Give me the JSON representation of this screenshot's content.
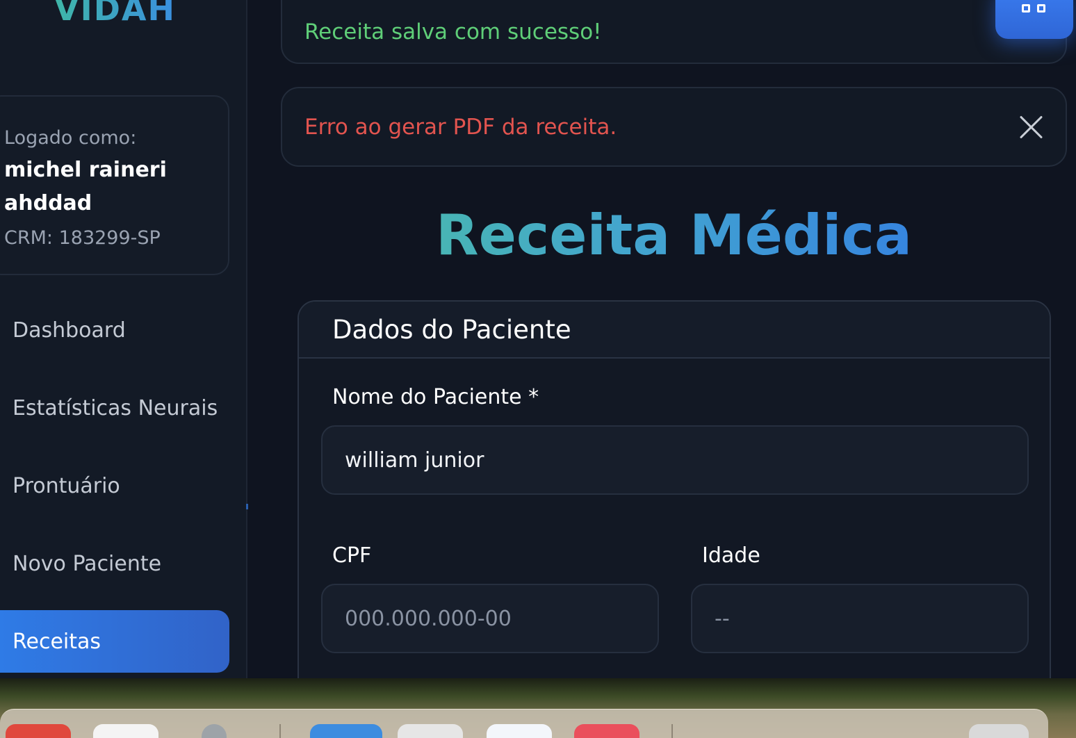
{
  "sidebar": {
    "brand": "VIDAH",
    "user": {
      "logged_as_label": "Logado como:",
      "name": "michel raineri ahddad",
      "crm": "CRM: 183299-SP"
    },
    "nav": [
      {
        "label": "Dashboard",
        "active": false
      },
      {
        "label": "Estatísticas Neurais",
        "active": false
      },
      {
        "label": "Prontuário",
        "active": false
      },
      {
        "label": "Novo Paciente",
        "active": false
      },
      {
        "label": "Receitas",
        "active": true
      }
    ]
  },
  "alerts": {
    "success": "Receita salva com sucesso!",
    "error": "Erro ao gerar PDF da receita."
  },
  "page": {
    "title": "Receita Médica"
  },
  "patient_card": {
    "header": "Dados do Paciente",
    "name_label": "Nome do Paciente *",
    "name_value": "william junior",
    "cpf_label": "CPF",
    "cpf_placeholder": "000.000.000-00",
    "age_label": "Idade",
    "age_placeholder": "--"
  },
  "colors": {
    "accent": "#2f7be6",
    "success": "#5fce78",
    "error": "#e2544f",
    "background": "#0f1420"
  },
  "icons": {
    "close": "close-icon",
    "float_button": "grid-icon"
  }
}
